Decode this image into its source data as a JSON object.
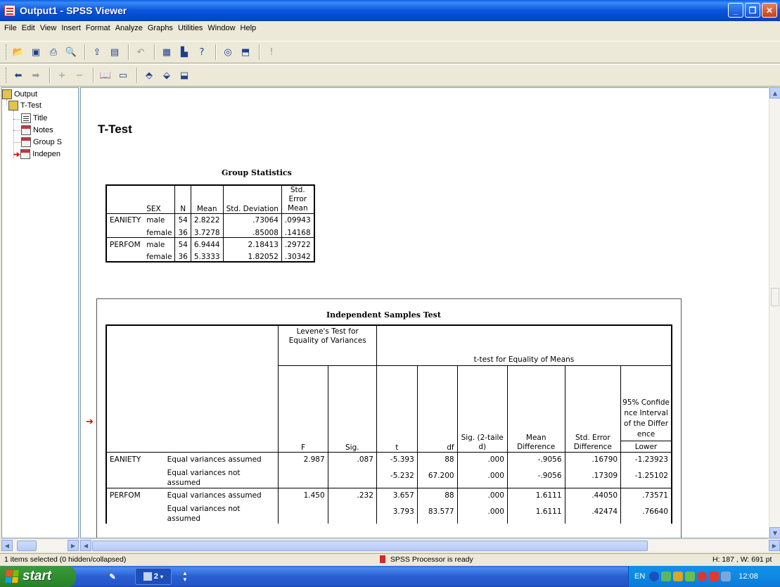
{
  "window": {
    "title": "Output1 - SPSS Viewer"
  },
  "menu": [
    "File",
    "Edit",
    "View",
    "Insert",
    "Format",
    "Analyze",
    "Graphs",
    "Utilities",
    "Window",
    "Help"
  ],
  "toolbar1": [
    {
      "icon": "open-folder-icon"
    },
    {
      "icon": "save-icon"
    },
    {
      "icon": "print-icon"
    },
    {
      "icon": "print-preview-icon"
    },
    {
      "icon": "export-icon"
    },
    {
      "icon": "recall-dialog-icon"
    },
    {
      "icon": "undo-icon"
    },
    {
      "icon": "goto-data-icon"
    },
    {
      "icon": "goto-chart-icon"
    },
    {
      "icon": "variables-icon"
    },
    {
      "icon": "designate-window-icon"
    },
    {
      "icon": "select-last-output-icon"
    },
    {
      "icon": "run-icon"
    }
  ],
  "toolbar2": [
    {
      "icon": "promote-icon"
    },
    {
      "icon": "demote-icon"
    },
    {
      "icon": "expand-icon"
    },
    {
      "icon": "collapse-icon"
    },
    {
      "icon": "show-icon"
    },
    {
      "icon": "hide-icon"
    },
    {
      "icon": "insert-heading-icon"
    },
    {
      "icon": "insert-title-icon"
    },
    {
      "icon": "insert-text-icon"
    }
  ],
  "outline": {
    "items": [
      {
        "label": "Output",
        "level": 0,
        "icon": "book-icon"
      },
      {
        "label": "T-Test",
        "level": 1,
        "icon": "book-icon"
      },
      {
        "label": "Title",
        "level": 2,
        "icon": "title-icon"
      },
      {
        "label": "Notes",
        "level": 2,
        "icon": "notes-icon"
      },
      {
        "label": "Group S",
        "level": 2,
        "icon": "table-icon"
      },
      {
        "label": "Indepen",
        "level": 2,
        "icon": "table-icon",
        "selected": true
      }
    ]
  },
  "content": {
    "heading": "T-Test",
    "group_statistics": {
      "title": "Group Statistics",
      "headers": [
        "",
        "SEX",
        "N",
        "Mean",
        "Std. Deviation",
        "Std. Error Mean"
      ],
      "rows": [
        {
          "var": "EANIETY",
          "sex": "male",
          "n": "54",
          "mean": "2.8222",
          "sd": ".73064",
          "se": ".09943"
        },
        {
          "var": "",
          "sex": "female",
          "n": "36",
          "mean": "3.7278",
          "sd": ".85008",
          "se": ".14168"
        },
        {
          "var": "PERFOM",
          "sex": "male",
          "n": "54",
          "mean": "6.9444",
          "sd": "2.18413",
          "se": ".29722"
        },
        {
          "var": "",
          "sex": "female",
          "n": "36",
          "mean": "5.3333",
          "sd": "1.82052",
          "se": ".30342"
        }
      ]
    },
    "independent_samples": {
      "title": "Independent Samples Test",
      "levene_header": "Levene's Test for Equality of Variances",
      "ttest_header": "t-test for Equality of Means",
      "ci_header": "95% Confidence Interval of the Difference",
      "col_headers": {
        "f": "F",
        "sig": "Sig.",
        "t": "t",
        "df": "df",
        "sig2": "Sig. (2-tailed)",
        "mean_diff": "Mean Difference",
        "se_diff": "Std. Error Difference",
        "lower": "Lower"
      },
      "rows": [
        {
          "var": "EANIETY",
          "assump": "Equal variances assumed",
          "f": "2.987",
          "sig": ".087",
          "t": "-5.393",
          "df": "88",
          "sig2": ".000",
          "md": "-.9056",
          "sed": ".16790",
          "lower": "-1.23923"
        },
        {
          "var": "",
          "assump": "Equal variances not assumed",
          "f": "",
          "sig": "",
          "t": "-5.232",
          "df": "67.200",
          "sig2": ".000",
          "md": "-.9056",
          "sed": ".17309",
          "lower": "-1.25102"
        },
        {
          "var": "PERFOM",
          "assump": "Equal variances assumed",
          "f": "1.450",
          "sig": ".232",
          "t": "3.657",
          "df": "88",
          "sig2": ".000",
          "md": "1.6111",
          "sed": ".44050",
          "lower": ".73571"
        },
        {
          "var": "",
          "assump": "Equal variances not assumed",
          "f": "",
          "sig": "",
          "t": "3.793",
          "df": "83.577",
          "sig2": ".000",
          "md": "1.6111",
          "sed": ".42474",
          "lower": ".76640"
        }
      ]
    }
  },
  "status": {
    "selection": "1 items selected (0 hidden/collapsed)",
    "processor": "SPSS Processor  is ready",
    "size": "H: 187 , W: 691 pt"
  },
  "taskbar": {
    "start": "start",
    "group_label": "2",
    "lang": "EN",
    "clock": "12:08"
  }
}
